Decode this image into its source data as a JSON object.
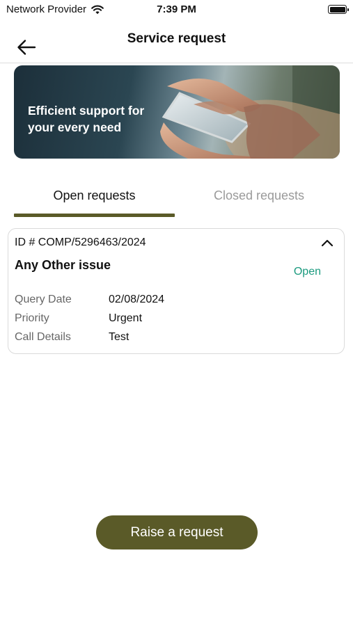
{
  "status_bar": {
    "carrier": "Network Provider",
    "time": "7:39 PM",
    "wifi_icon": "wifi-icon",
    "battery_icon": "battery-icon"
  },
  "header": {
    "title": "Service request",
    "back_icon": "arrow-left-icon"
  },
  "banner": {
    "text": "Efficient support for your every need"
  },
  "tabs": [
    {
      "label": "Open requests",
      "active": true
    },
    {
      "label": "Closed requests",
      "active": false
    }
  ],
  "requests": [
    {
      "id": "ID # COMP/5296463/2024",
      "issue": "Any Other issue",
      "status": "Open",
      "expanded": true,
      "details": [
        {
          "label": "Query Date",
          "value": "02/08/2024"
        },
        {
          "label": "Priority",
          "value": "Urgent"
        },
        {
          "label": "Call Details",
          "value": "Test"
        }
      ]
    }
  ],
  "actions": {
    "raise_request_label": "Raise a request"
  },
  "colors": {
    "primary": "#5a5a28",
    "status_open": "#1a9a7e",
    "inactive_tab": "#9a9a9a",
    "card_border": "#dadada"
  }
}
